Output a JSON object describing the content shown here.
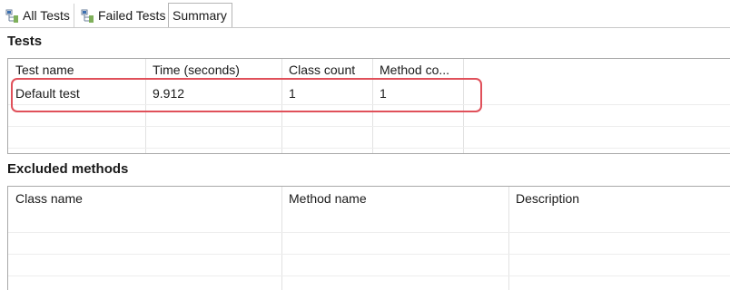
{
  "tabs": [
    {
      "label": "All Tests",
      "icon": "test-tree-icon",
      "active": false
    },
    {
      "label": "Failed Tests",
      "icon": "test-tree-icon",
      "active": false
    },
    {
      "label": "Summary",
      "active": true
    }
  ],
  "tests": {
    "title": "Tests",
    "columns": [
      "Test name",
      "Time (seconds)",
      "Class count",
      "Method co..."
    ],
    "rows": [
      [
        "Default test",
        "9.912",
        "1",
        "1"
      ]
    ]
  },
  "excluded": {
    "title": "Excluded methods",
    "columns": [
      "Class name",
      "Method name",
      "Description"
    ],
    "rows": []
  },
  "colors": {
    "highlight": "#e0505a",
    "border": "#a9a9a9",
    "icon_blue": "#3a6fb0"
  }
}
